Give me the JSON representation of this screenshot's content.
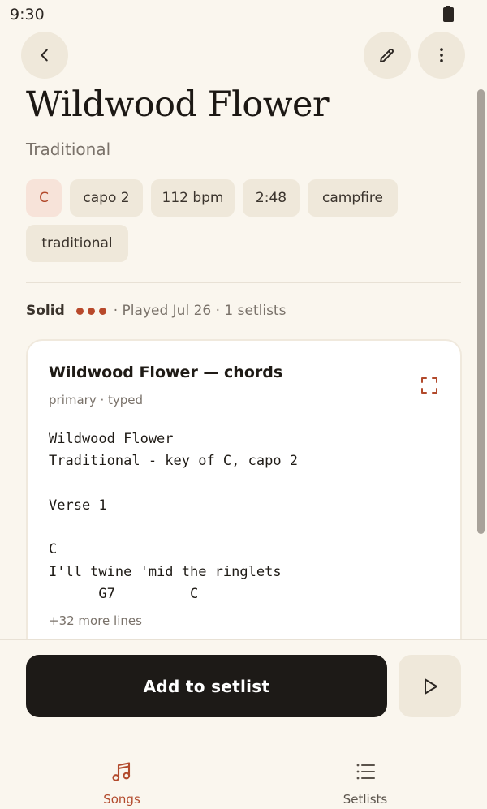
{
  "status_bar": {
    "time": "9:30"
  },
  "song": {
    "title": "Wildwood Flower",
    "artist": "Traditional",
    "chips": [
      {
        "label": "C",
        "kind": "key"
      },
      {
        "label": "capo 2",
        "kind": "tag"
      },
      {
        "label": "112 bpm",
        "kind": "tag"
      },
      {
        "label": "2:48",
        "kind": "tag"
      },
      {
        "label": "campfire",
        "kind": "tag"
      },
      {
        "label": "traditional",
        "kind": "tag"
      }
    ],
    "proficiency": {
      "label": "Solid",
      "level": 3,
      "max": 3
    },
    "meta": "· Played Jul 26 · 1 setlists"
  },
  "chart_card": {
    "title": "Wildwood Flower — chords",
    "subtitle": "primary · typed",
    "lines": [
      "Wildwood Flower",
      "Traditional - key of C, capo 2",
      "",
      "Verse 1",
      "",
      "C",
      "I'll twine 'mid the ringlets",
      "      G7         C"
    ],
    "more_lines": "+32 more lines"
  },
  "actions": {
    "add_to_setlist": "Add to setlist"
  },
  "nav": {
    "songs": "Songs",
    "setlists": "Setlists"
  },
  "colors": {
    "background": "#faf6ee",
    "accent": "#b24a2c",
    "chip": "#efe8da",
    "key_chip": "#f7e3d9",
    "primary_button": "#1d1a17"
  },
  "icons": {
    "back": "chevron-left-icon",
    "edit": "pencil-icon",
    "more": "more-vertical-icon",
    "expand": "expand-icon",
    "play": "play-icon",
    "songs": "music-note-icon",
    "setlists": "list-icon"
  }
}
